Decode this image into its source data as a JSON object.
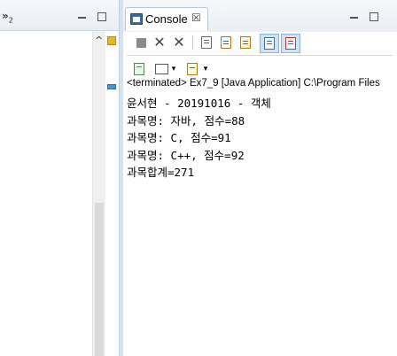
{
  "left_view": {
    "overflow_chevron": "»",
    "overflow_count": "2",
    "scroll_up_arrow": "^"
  },
  "console_view": {
    "tab_label": "Console",
    "tab_close_glyph": "☒",
    "tab_icon": "console-icon",
    "minimize_icon": "minimize-icon",
    "maximize_icon": "maximize-icon",
    "toolbar_icons": [
      "terminate-icon",
      "remove-launch-icon",
      "remove-all-terminated-icon",
      "clear-console-icon",
      "scroll-lock-icon",
      "word-wrap-icon",
      "show-on-stdout-icon",
      "show-on-stderr-icon",
      "pin-console-icon",
      "display-selected-console-icon",
      "open-console-icon"
    ],
    "dropdown_arrow": "▾",
    "status": "<terminated> Ex7_9 [Java Application] C:\\Program Files",
    "output_lines": [
      "윤서현 - 20191016 - 객체",
      "과목명: 자바, 점수=88",
      "과목명: C, 점수=91",
      "과목명: C++, 점수=92",
      "과목합계=271"
    ]
  },
  "colors": {
    "header_gradient_top": "#f6f8fb",
    "header_gradient_bottom": "#e9eef4",
    "selected_toggle": "#cfe2f7",
    "terminate_disabled": "#8a8a8a"
  }
}
